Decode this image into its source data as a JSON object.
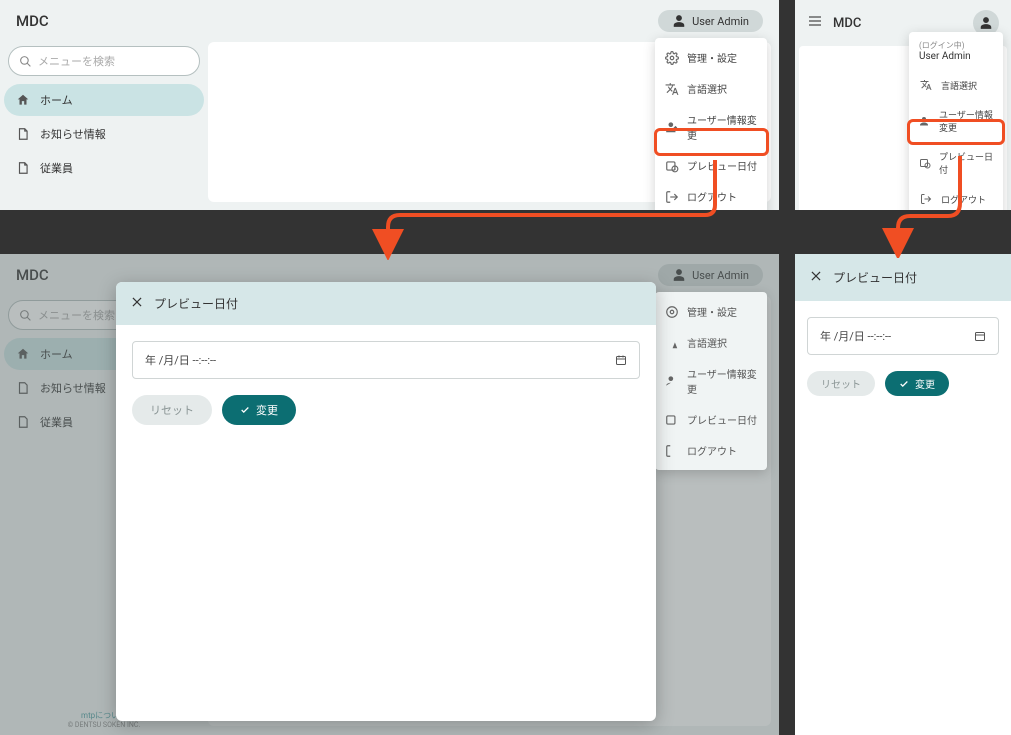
{
  "app": {
    "title": "MDC"
  },
  "user": {
    "label": "User Admin",
    "logged_in_label": "(ログイン中)"
  },
  "search": {
    "placeholder": "メニューを検索"
  },
  "sidebar": {
    "items": [
      {
        "label": "ホーム"
      },
      {
        "label": "お知らせ情報"
      },
      {
        "label": "従業員"
      }
    ]
  },
  "menu": {
    "admin_settings": "管理・設定",
    "language": "言語選択",
    "user_info": "ユーザー情報変更",
    "preview_date": "プレビュー日付",
    "logout": "ログアウト"
  },
  "modal": {
    "title": "プレビュー日付",
    "date_placeholder": "年 /月/日 --:--:--",
    "reset": "リセット",
    "submit": "変更"
  },
  "footer": {
    "link": "mtpについて",
    "copy": "© DENTSU SOKEN INC."
  }
}
